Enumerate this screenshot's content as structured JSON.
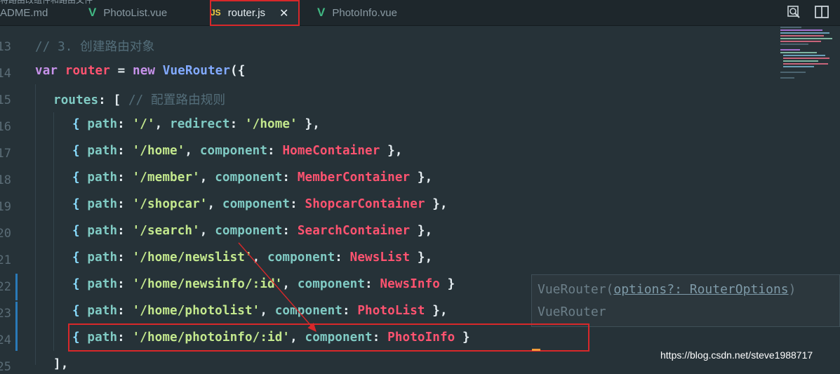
{
  "window": {
    "top_title": "将路由改组件和路由文件",
    "tabs": [
      {
        "label": "ADME.md",
        "icon": "none"
      },
      {
        "label": "PhotoList.vue",
        "icon": "vue-icon"
      },
      {
        "label": "router.js",
        "icon": "js-icon",
        "active": true,
        "badge": "JS",
        "close": "✕"
      },
      {
        "label": "PhotoInfo.vue",
        "icon": "vue-icon"
      }
    ],
    "actions": [
      "open-preview-icon",
      "split-editor-icon"
    ]
  },
  "editor": {
    "line_numbers": [
      "13",
      "14",
      "15",
      "16",
      "17",
      "18",
      "19",
      "20",
      "21",
      "22",
      "23",
      "24",
      "25"
    ],
    "lines": [
      {
        "comment": "// 3. 创建路由对象"
      },
      {
        "kw": "var",
        "name": "router",
        "eq": " = ",
        "new": "new",
        "cls": "VueRouter",
        "open": "({"
      },
      {
        "key": "routes",
        "after": ": [ ",
        "comment": "// 配置路由规则"
      },
      {
        "path": "'/'",
        "prop2": "redirect",
        "value": "'/home'",
        "close": " },"
      },
      {
        "path": "'/home'",
        "prop2": "component",
        "value": "HomeContainer",
        "close": " },"
      },
      {
        "path": "'/member'",
        "prop2": "component",
        "value": "MemberContainer",
        "close": " },"
      },
      {
        "path": "'/shopcar'",
        "prop2": "component",
        "value": "ShopcarContainer",
        "close": " },"
      },
      {
        "path": "'/search'",
        "prop2": "component",
        "value": "SearchContainer",
        "close": " },"
      },
      {
        "path": "'/home/newslist'",
        "prop2": "component",
        "value": "NewsList",
        "close": " },"
      },
      {
        "path": "'/home/newsinfo/:id'",
        "prop2": "component",
        "value": "NewsInfo",
        "close": " }"
      },
      {
        "path": "'/home/photolist'",
        "prop2": "component",
        "value": "PhotoList",
        "close": " },"
      },
      {
        "path": "'/home/photoinfo/:id'",
        "prop2": "component",
        "value": "PhotoInfo",
        "close": " }"
      },
      {
        "close_array": "],"
      }
    ],
    "path_key": "path",
    "open_brace": "{ ",
    "colon": ": ",
    "comma": ", "
  },
  "hover": {
    "line1_prefix": "VueRouter(",
    "line1_param": "options?: RouterOptions",
    "line1_suffix": ")",
    "line2": "VueRouter"
  },
  "watermark": "https://blog.csdn.net/steve1988717",
  "colors": {
    "background": "#263238",
    "annotation": "#d8282a",
    "keyword": "#c792ea",
    "property": "#80cbc4",
    "string": "#c3e88d",
    "class": "#ff5370"
  }
}
